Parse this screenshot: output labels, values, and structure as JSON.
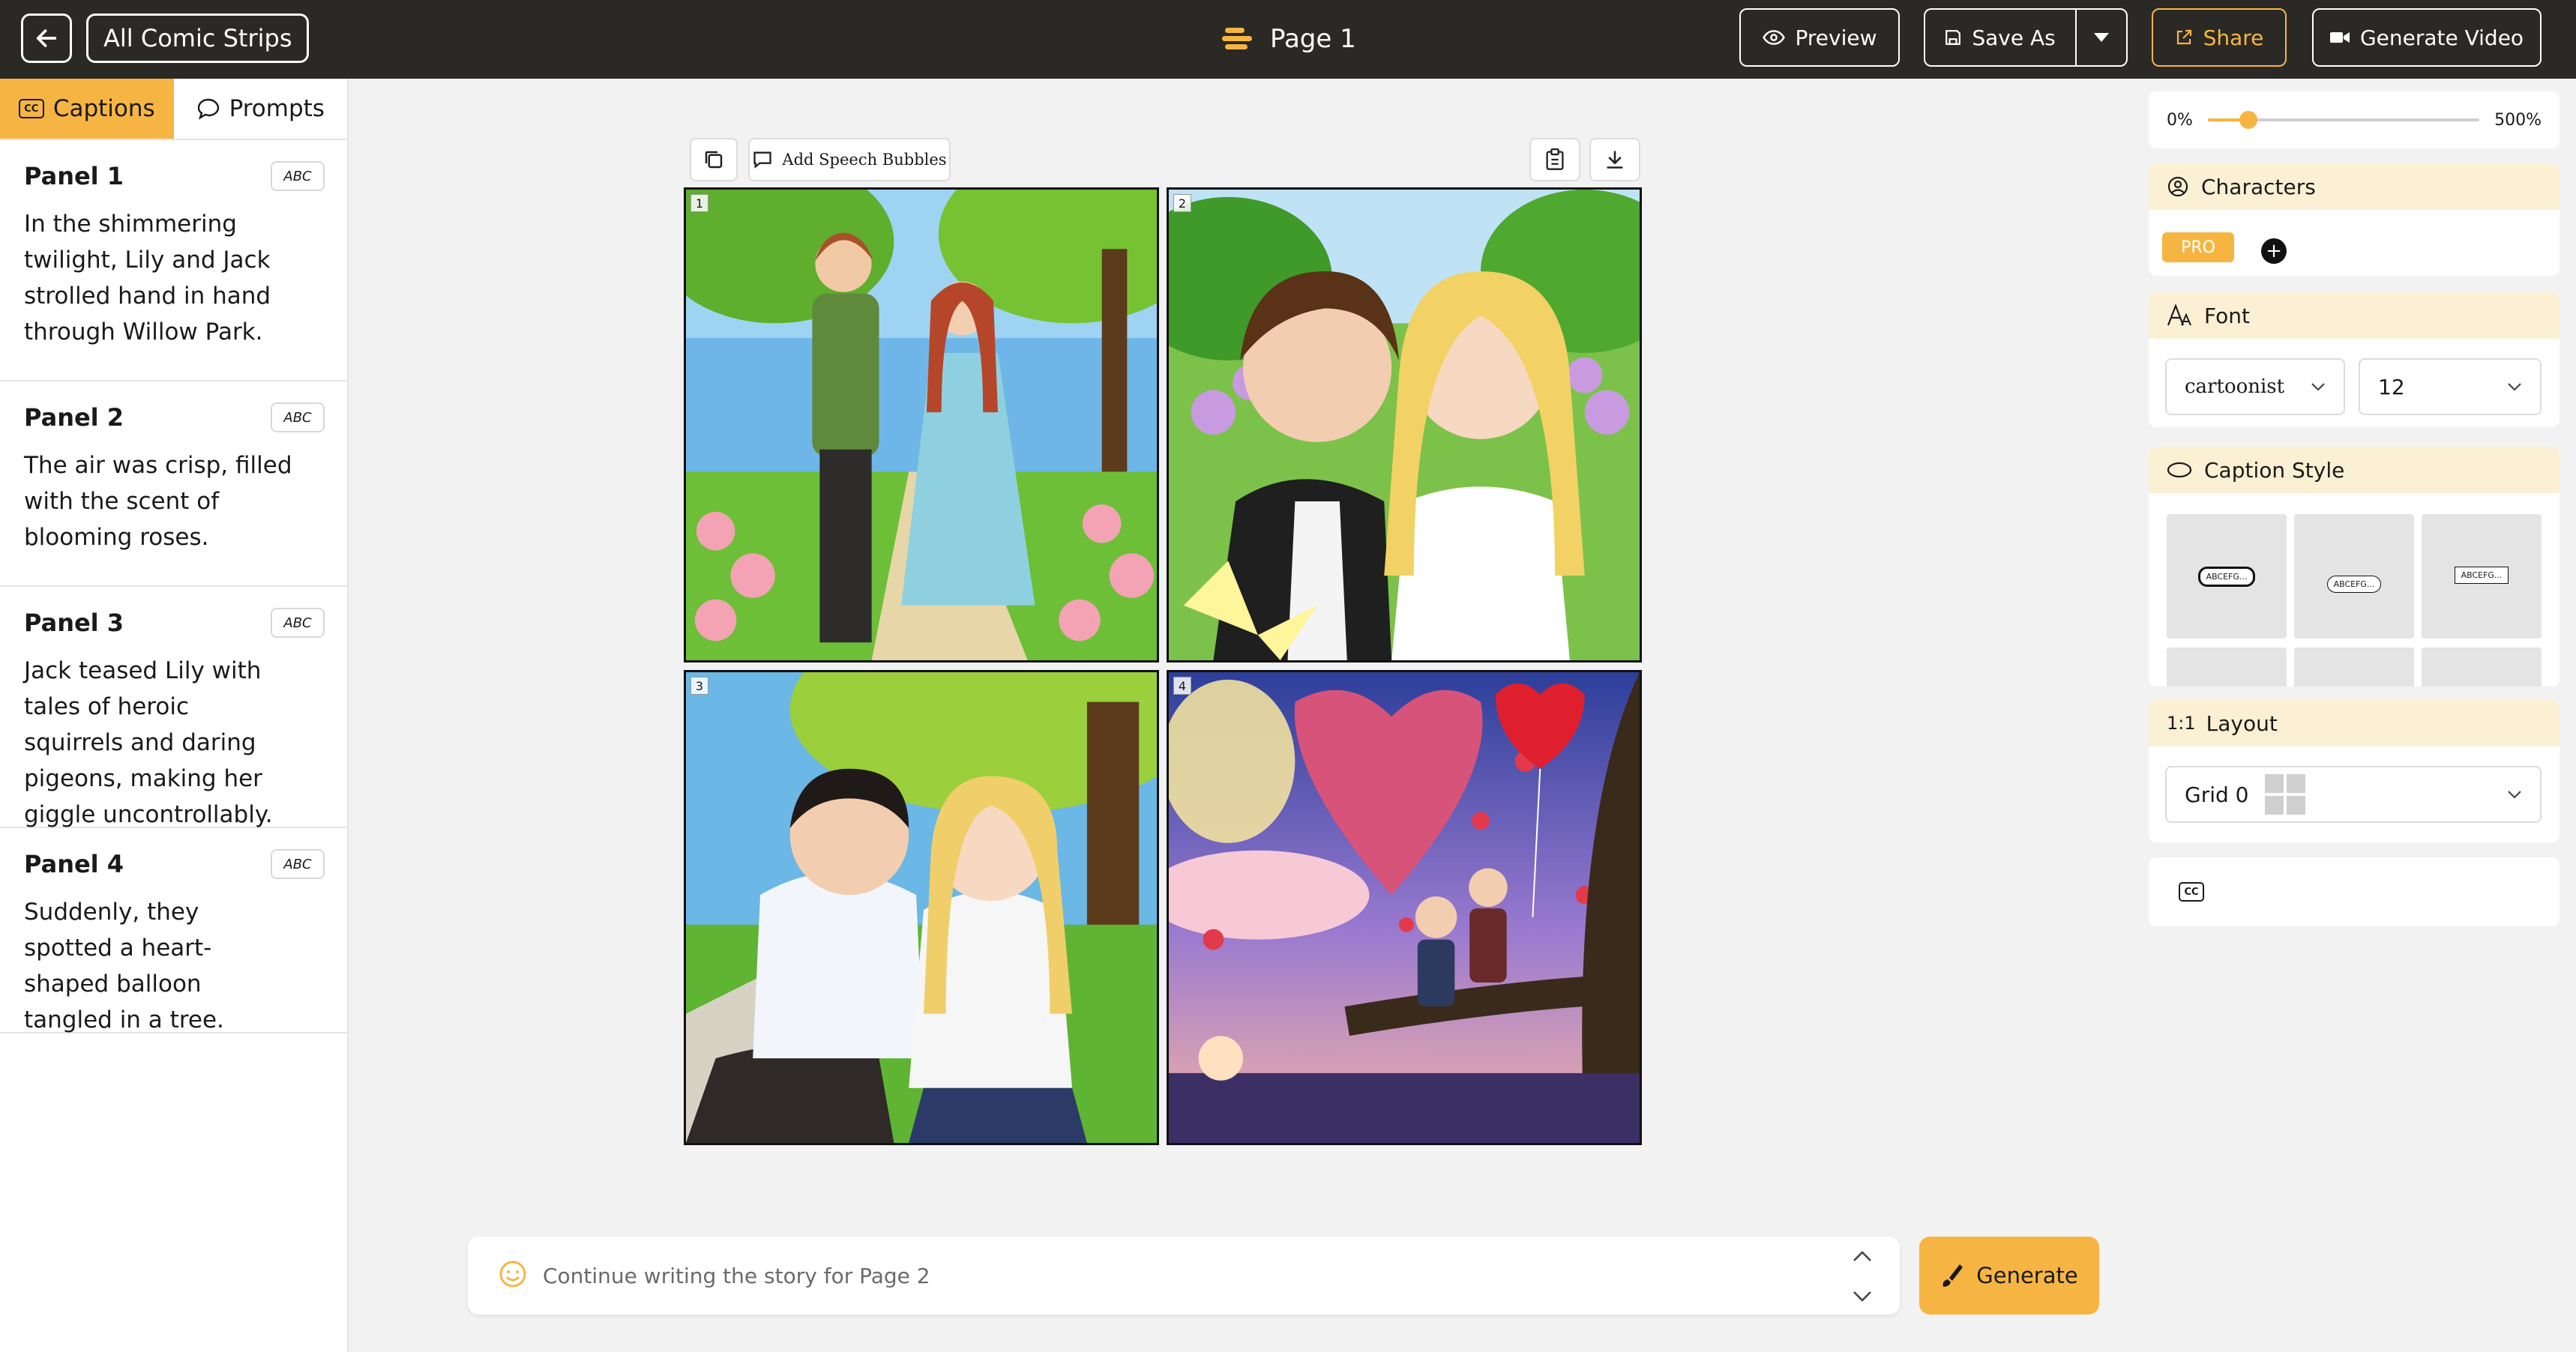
{
  "topbar": {
    "back_icon": "arrow-left-icon",
    "all_strips_label": "All Comic Strips",
    "page_title": "Page 1",
    "preview_label": "Preview",
    "save_as_label": "Save As",
    "share_label": "Share",
    "generate_video_label": "Generate Video"
  },
  "left_panel": {
    "tabs": [
      {
        "label": "Captions",
        "active": true
      },
      {
        "label": "Prompts",
        "active": false
      }
    ],
    "abc_label": "ABC",
    "panels": [
      {
        "title": "Panel 1",
        "text": "In the shimmering twilight, Lily and Jack strolled hand in hand through Willow Park."
      },
      {
        "title": "Panel 2",
        "text": "The air was crisp, filled with the scent of blooming roses."
      },
      {
        "title": "Panel 3",
        "text": "Jack teased Lily with tales of heroic squirrels and daring pigeons, making her giggle uncontrollably."
      },
      {
        "title": "Panel 4",
        "text": "Suddenly, they spotted a heart-shaped balloon tangled in a tree."
      }
    ]
  },
  "canvas": {
    "add_bubbles_label": "Add Speech Bubbles",
    "panel_numbers": [
      "1",
      "2",
      "3",
      "4"
    ]
  },
  "prompt": {
    "placeholder": "Continue writing the story for Page 2",
    "generate_label": "Generate"
  },
  "right_panel": {
    "zoom": {
      "min_label": "0%",
      "max_label": "500%",
      "value_fraction": 0.15
    },
    "characters": {
      "title": "Characters",
      "pro_label": "PRO"
    },
    "font": {
      "title": "Font",
      "family": "cartoonist",
      "size": "12"
    },
    "caption_style": {
      "title": "Caption Style",
      "sample_text": "ABCEFG..."
    },
    "layout": {
      "title": "Layout",
      "ratio_label": "1:1",
      "selected": "Grid 0"
    }
  },
  "colors": {
    "accent": "#f6b543",
    "topbar": "#2a2926",
    "card_header": "#fbf0d3"
  }
}
